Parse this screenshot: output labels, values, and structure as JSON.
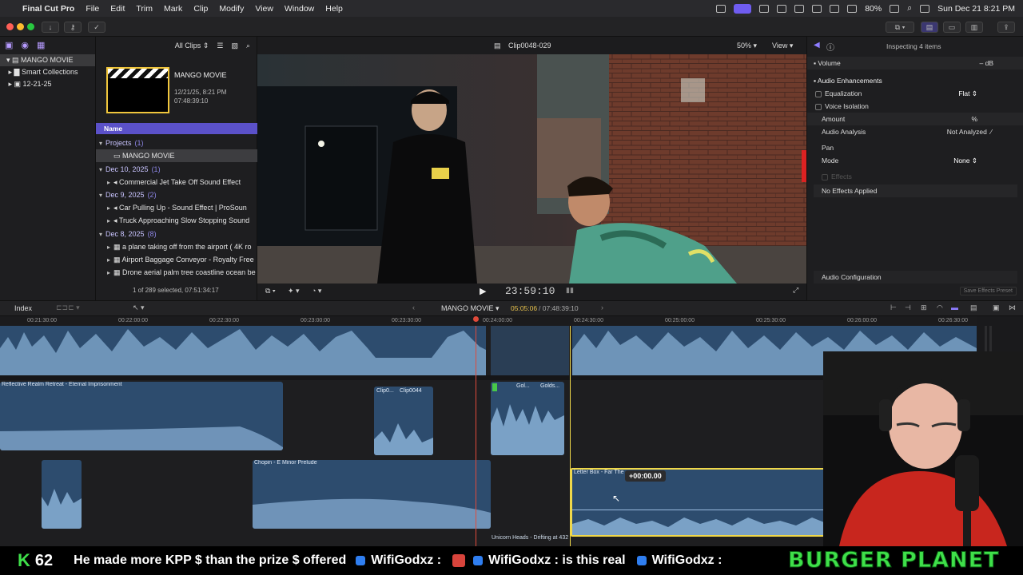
{
  "menubar": {
    "app_name": "Final Cut Pro",
    "items": [
      "File",
      "Edit",
      "Trim",
      "Mark",
      "Clip",
      "Modify",
      "View",
      "Window",
      "Help"
    ],
    "battery": "80%",
    "datetime": "Sun Dec 21  8:21 PM"
  },
  "sidebar": {
    "library": "MANGO MOVIE",
    "items": [
      "Smart Collections",
      "12-21-25"
    ]
  },
  "browser": {
    "filter": "All Clips",
    "project_title": "MANGO MOVIE",
    "project_date": "12/21/25, 8:21 PM",
    "project_duration": "07:48:39:10",
    "column_name": "Name",
    "groups": [
      {
        "label": "Projects",
        "count": "(1)",
        "items": [
          "MANGO MOVIE"
        ]
      },
      {
        "label": "Dec 10, 2025",
        "count": "(1)",
        "items": [
          "Commercial Jet Take Off Sound Effect"
        ]
      },
      {
        "label": "Dec 9, 2025",
        "count": "(2)",
        "items": [
          "Car Pulling Up - Sound Effect  |  ProSoun",
          "Truck Approaching Slow Stopping Sound"
        ]
      },
      {
        "label": "Dec 8, 2025",
        "count": "(8)",
        "items": [
          "a plane taking off from the airport ( 4K ro",
          "Airport Baggage Conveyor - Royalty Free",
          "Drone aerial palm tree coastline ocean be"
        ]
      }
    ],
    "footer": "1 of 289 selected, 07:51:34:17"
  },
  "viewer": {
    "clip_name": "Clip0048-029",
    "zoom": "50%",
    "view_label": "View",
    "timecode": "23:59:10"
  },
  "inspector": {
    "header": "Inspecting 4 items",
    "volume_label": "Volume",
    "volume_value": "– dB",
    "section_enh": "Audio Enhancements",
    "equalization": "Equalization",
    "eq_value": "Flat",
    "voice_isolation": "Voice Isolation",
    "amount": "Amount",
    "amount_unit": "%",
    "audio_analysis": "Audio Analysis",
    "analysis_value": "Not Analyzed",
    "pan": "Pan",
    "mode": "Mode",
    "mode_value": "None",
    "effects": "Effects",
    "no_effects": "No Effects Applied",
    "audio_config": "Audio Configuration",
    "save_preset": "Save Effects Preset"
  },
  "timeline": {
    "index_label": "Index",
    "project": "MANGO MOVIE",
    "position": "05:05:06",
    "duration": "07:48:39:10",
    "ruler": [
      "00:21:30:00",
      "00:22:00:00",
      "00:22:30:00",
      "00:23:00:00",
      "00:23:30:00",
      "00:24:00:00",
      "00:24:30:00",
      "00:25:00:00",
      "00:25:30:00",
      "00:26:00:00",
      "00:26:30:00"
    ],
    "clips": {
      "reflective": "Reflective Realm Retreat - Eternal Imprisonment",
      "clip_a": "Clip0...",
      "clip_b": "Clip0044",
      "gold_a": "Gol...",
      "gold_b": "Golds...",
      "chopin": "Chopin - E Minor Prelude",
      "letterbox": "Letter Box - Far The",
      "unicorn": "Unicorn Heads - Drifting at 432",
      "offset": "+00:00.00"
    }
  },
  "ticker": {
    "k": "K",
    "kp": "62",
    "message": "He made more KPP $ than the prize $ offered",
    "user1": "WifiGodxz :",
    "user2": "WifiGodxz : is this real",
    "user3": "WifiGodxz :",
    "brand": "BURGER PLANET"
  },
  "colors": {
    "accent": "#6f5cf0",
    "clip_blue": "#2d4c6e",
    "playhead": "#e04a3a",
    "selection": "#f0d84a"
  }
}
